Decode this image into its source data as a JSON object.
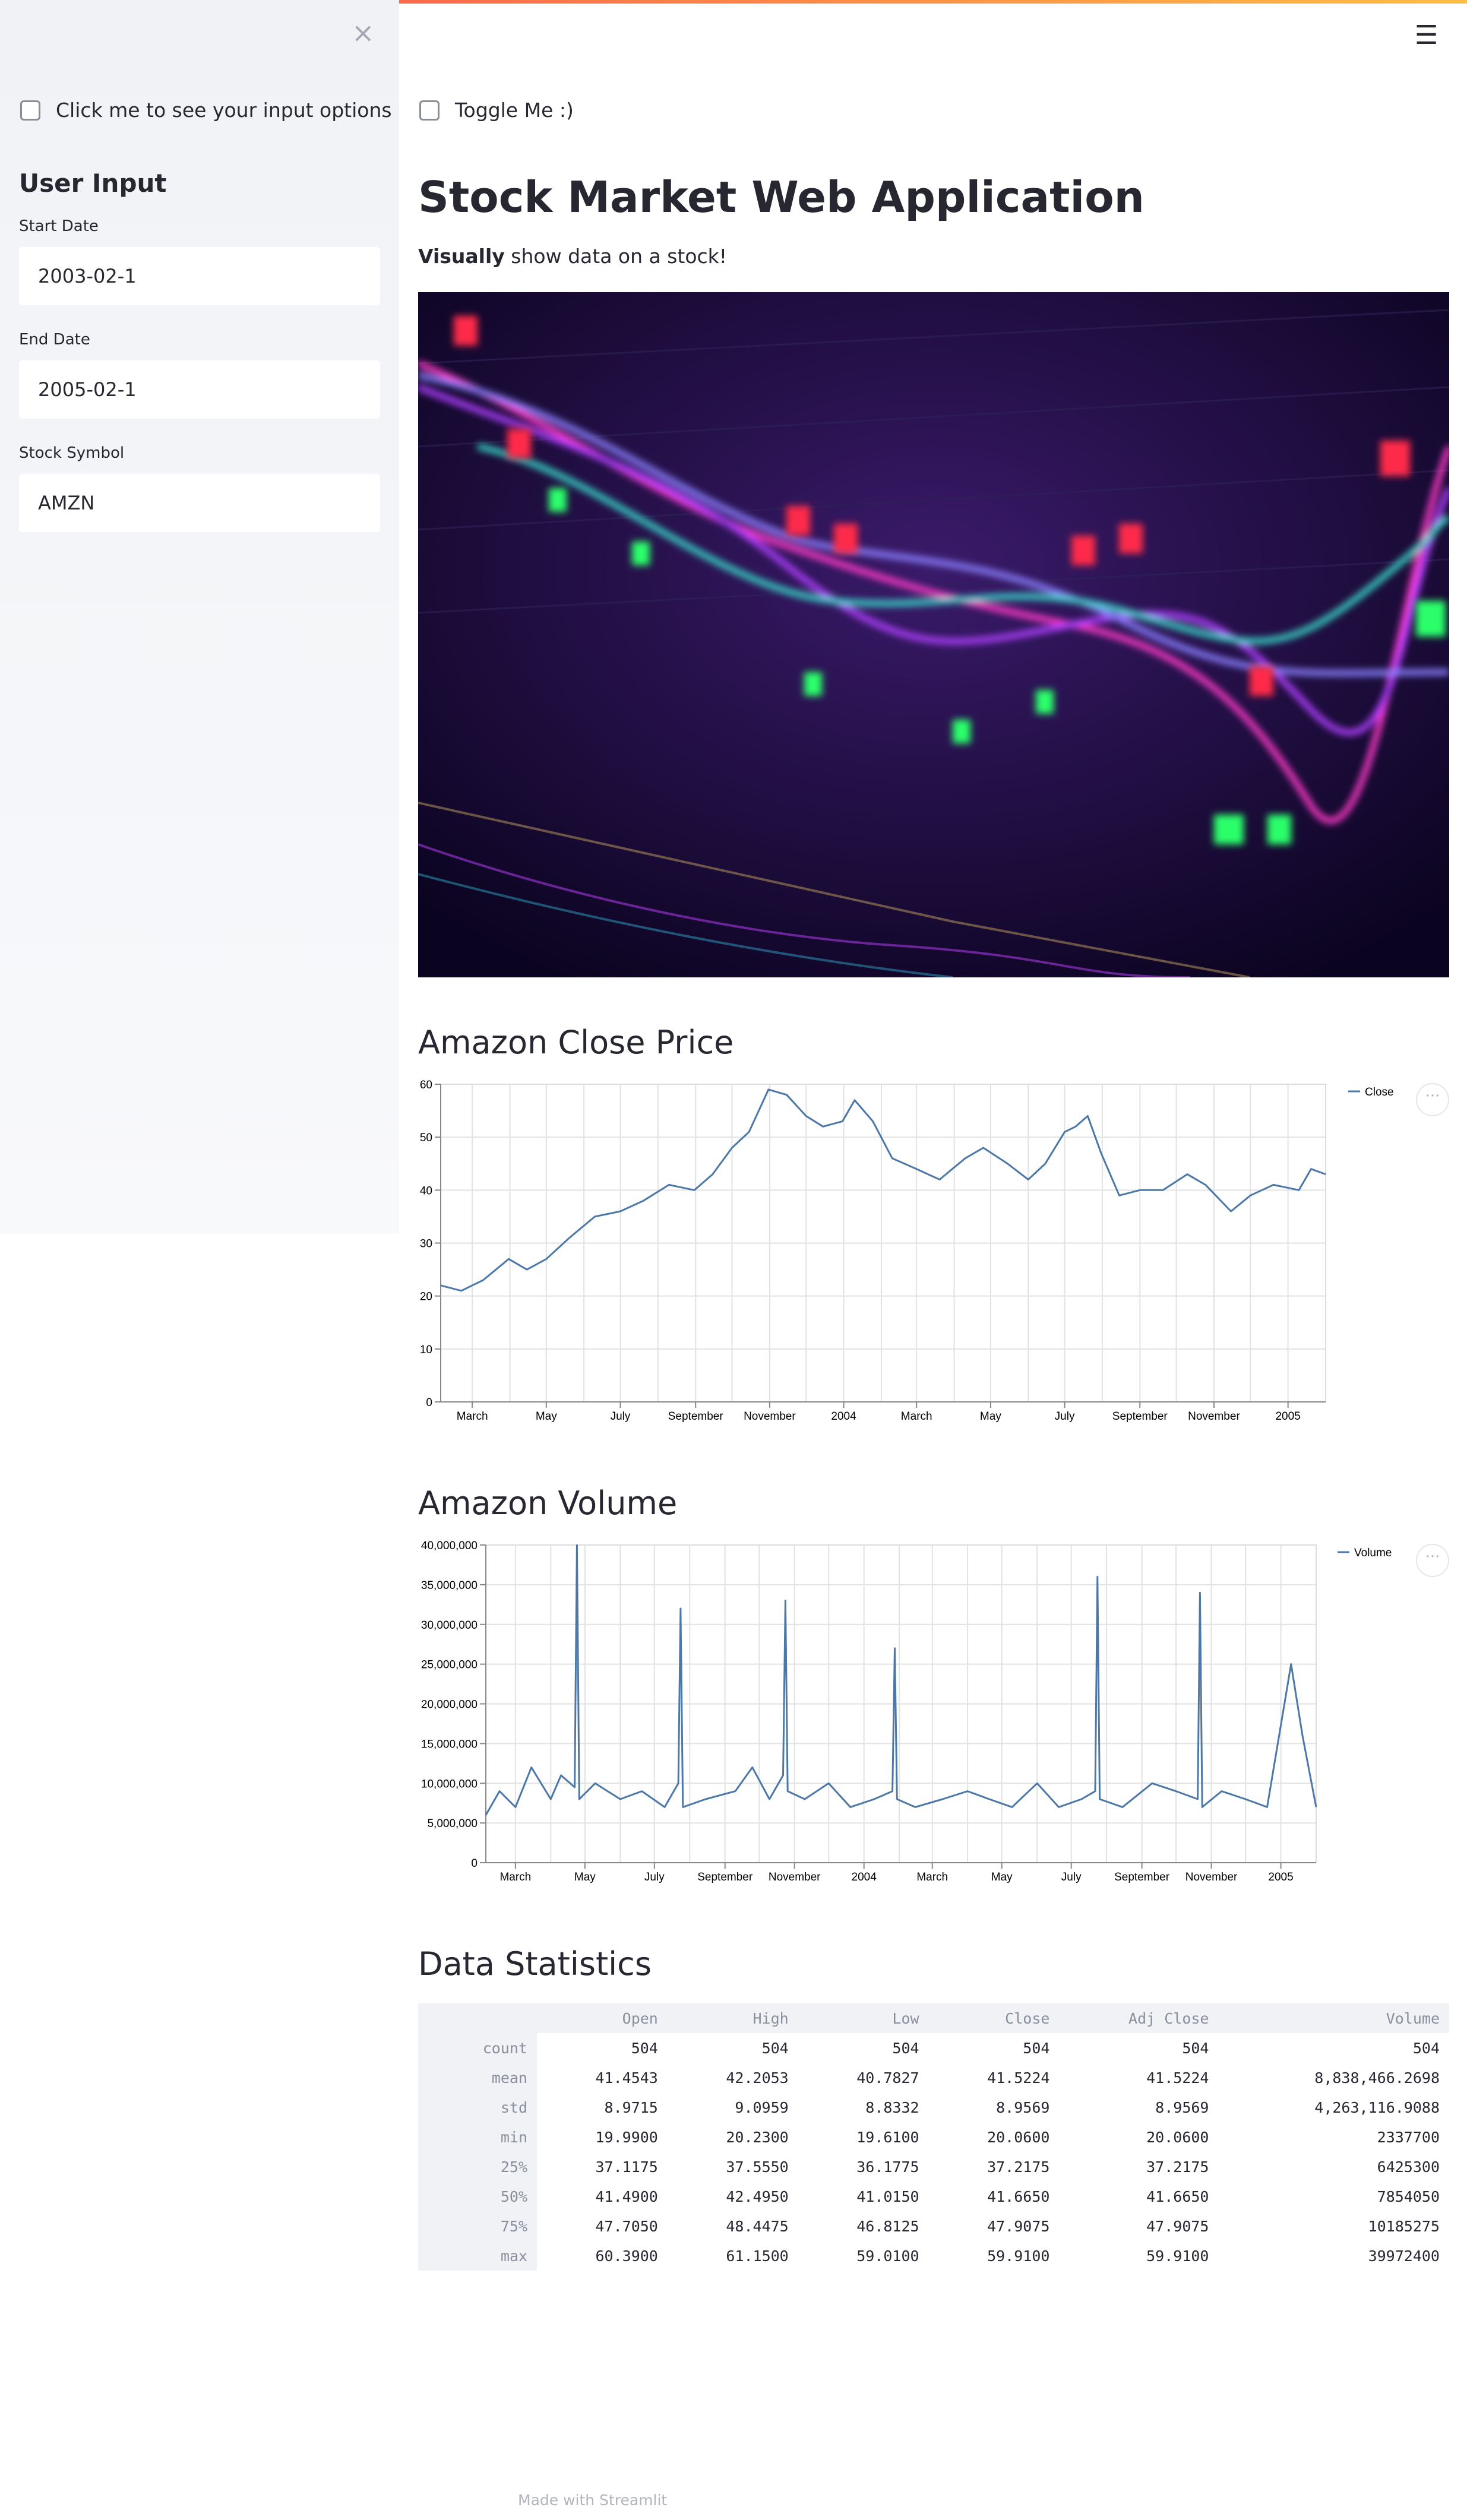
{
  "sidebar": {
    "close_label": "×",
    "checkbox_label": "Click me to see your input options",
    "heading": "User Input",
    "fields": [
      {
        "label": "Start Date",
        "value": "2003-02-1"
      },
      {
        "label": "End Date",
        "value": "2005-02-1"
      },
      {
        "label": "Stock Symbol",
        "value": "AMZN"
      }
    ]
  },
  "header": {
    "menu_icon": "☰"
  },
  "main": {
    "toggle_label": "Toggle Me :)",
    "title": "Stock Market Web Application",
    "subtitle_bold": "Visually",
    "subtitle_rest": " show data on a stock!",
    "close_heading": "Amazon Close Price",
    "volume_heading": "Amazon Volume",
    "stats_heading": "Data Statistics",
    "footer": "Made with Streamlit"
  },
  "stats_table": {
    "columns": [
      "",
      "Open",
      "High",
      "Low",
      "Close",
      "Adj Close",
      "Volume"
    ],
    "rows": [
      [
        "count",
        "504",
        "504",
        "504",
        "504",
        "504",
        "504"
      ],
      [
        "mean",
        "41.4543",
        "42.2053",
        "40.7827",
        "41.5224",
        "41.5224",
        "8,838,466.2698"
      ],
      [
        "std",
        "8.9715",
        "9.0959",
        "8.8332",
        "8.9569",
        "8.9569",
        "4,263,116.9088"
      ],
      [
        "min",
        "19.9900",
        "20.2300",
        "19.6100",
        "20.0600",
        "20.0600",
        "2337700"
      ],
      [
        "25%",
        "37.1175",
        "37.5550",
        "36.1775",
        "37.2175",
        "37.2175",
        "6425300"
      ],
      [
        "50%",
        "41.4900",
        "42.4950",
        "41.0150",
        "41.6650",
        "41.6650",
        "7854050"
      ],
      [
        "75%",
        "47.7050",
        "48.4475",
        "46.8125",
        "47.9075",
        "47.9075",
        "10185275"
      ],
      [
        "max",
        "60.3900",
        "61.1500",
        "59.0100",
        "59.9100",
        "59.9100",
        "39972400"
      ]
    ]
  },
  "chart_data": [
    {
      "type": "line",
      "legend": "Close",
      "legend_position": "top-right",
      "color": "#4c78a8",
      "ylim": [
        0,
        60
      ],
      "yticks": [
        0,
        10,
        20,
        30,
        40,
        50,
        60
      ],
      "xticks": [
        "March",
        "May",
        "July",
        "September",
        "November",
        "2004",
        "March",
        "May",
        "July",
        "September",
        "November",
        "2005"
      ],
      "x_range": [
        "2003-02-03",
        "2005-02-01"
      ],
      "x": [
        "2003-02-03",
        "2003-02-20",
        "2003-03-10",
        "2003-03-31",
        "2003-04-15",
        "2003-05-01",
        "2003-05-20",
        "2003-06-10",
        "2003-07-01",
        "2003-07-20",
        "2003-08-10",
        "2003-08-31",
        "2003-09-15",
        "2003-10-01",
        "2003-10-15",
        "2003-10-31",
        "2003-11-15",
        "2003-12-01",
        "2003-12-15",
        "2003-12-31",
        "2004-01-10",
        "2004-01-25",
        "2004-02-10",
        "2004-03-01",
        "2004-03-20",
        "2004-04-10",
        "2004-04-25",
        "2004-05-15",
        "2004-06-01",
        "2004-06-15",
        "2004-07-01",
        "2004-07-10",
        "2004-07-20",
        "2004-07-31",
        "2004-08-15",
        "2004-09-01",
        "2004-09-20",
        "2004-10-10",
        "2004-10-25",
        "2004-11-15",
        "2004-12-01",
        "2004-12-20",
        "2005-01-10",
        "2005-01-20",
        "2005-02-01"
      ],
      "values": [
        22,
        21,
        23,
        27,
        25,
        27,
        31,
        35,
        36,
        38,
        41,
        40,
        43,
        48,
        51,
        59,
        58,
        54,
        52,
        53,
        57,
        53,
        46,
        44,
        42,
        46,
        48,
        45,
        42,
        45,
        51,
        52,
        54,
        47,
        39,
        40,
        40,
        43,
        41,
        36,
        39,
        41,
        40,
        44,
        43
      ]
    },
    {
      "type": "line",
      "legend": "Volume",
      "legend_position": "top-right",
      "color": "#4c78a8",
      "ylim": [
        0,
        40000000
      ],
      "yticks": [
        0,
        5000000,
        10000000,
        15000000,
        20000000,
        25000000,
        30000000,
        35000000,
        40000000
      ],
      "yticklabels": [
        "0",
        "5,000,000",
        "10,000,000",
        "15,000,000",
        "20,000,000",
        "25,000,000",
        "30,000,000",
        "35,000,000",
        "40,000,000"
      ],
      "xticks": [
        "March",
        "May",
        "July",
        "September",
        "November",
        "2004",
        "March",
        "May",
        "July",
        "September",
        "November",
        "2005"
      ],
      "x_range": [
        "2003-02-03",
        "2005-02-01"
      ],
      "x": [
        "2003-02-03",
        "2003-02-15",
        "2003-03-01",
        "2003-03-15",
        "2003-04-01",
        "2003-04-10",
        "2003-04-22",
        "2003-04-24",
        "2003-04-26",
        "2003-05-10",
        "2003-06-01",
        "2003-06-20",
        "2003-07-10",
        "2003-07-22",
        "2003-07-24",
        "2003-07-26",
        "2003-08-15",
        "2003-09-10",
        "2003-09-25",
        "2003-10-10",
        "2003-10-22",
        "2003-10-24",
        "2003-10-26",
        "2003-11-10",
        "2003-12-01",
        "2003-12-20",
        "2004-01-10",
        "2004-01-26",
        "2004-01-28",
        "2004-01-30",
        "2004-02-15",
        "2004-03-10",
        "2004-04-01",
        "2004-04-20",
        "2004-05-10",
        "2004-06-01",
        "2004-06-20",
        "2004-07-10",
        "2004-07-22",
        "2004-07-24",
        "2004-07-26",
        "2004-08-15",
        "2004-09-10",
        "2004-10-01",
        "2004-10-20",
        "2004-10-22",
        "2004-10-24",
        "2004-11-10",
        "2004-12-01",
        "2004-12-20",
        "2005-01-10",
        "2005-01-20",
        "2005-02-01"
      ],
      "values": [
        6000000,
        9000000,
        7000000,
        12000000,
        8000000,
        11000000,
        9500000,
        39972400,
        8000000,
        10000000,
        8000000,
        9000000,
        7000000,
        10000000,
        32000000,
        7000000,
        8000000,
        9000000,
        12000000,
        8000000,
        11000000,
        33000000,
        9000000,
        8000000,
        10000000,
        7000000,
        8000000,
        9000000,
        27000000,
        8000000,
        7000000,
        8000000,
        9000000,
        8000000,
        7000000,
        10000000,
        7000000,
        8000000,
        9000000,
        36000000,
        8000000,
        7000000,
        10000000,
        9000000,
        8000000,
        34000000,
        7000000,
        9000000,
        8000000,
        7000000,
        25000000,
        16000000,
        7000000
      ]
    }
  ]
}
